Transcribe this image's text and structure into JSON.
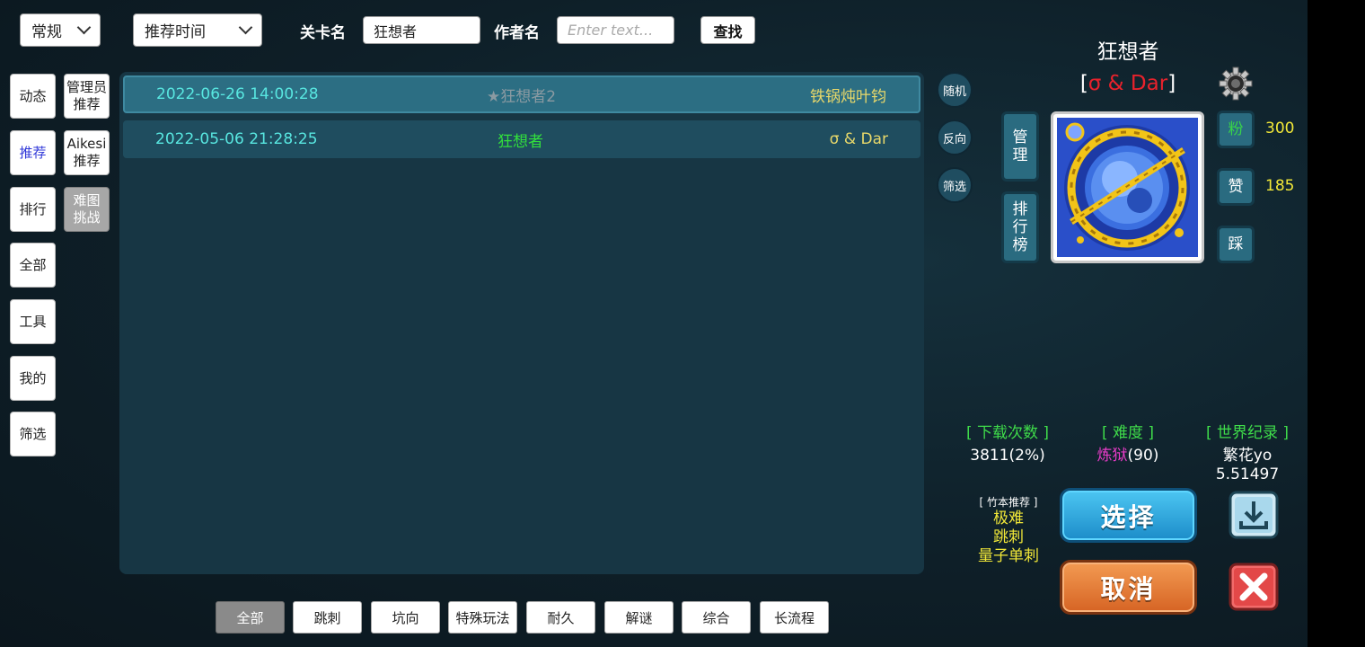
{
  "top": {
    "category_select": "常规",
    "sort_select": "推荐时间",
    "level_label": "关卡名",
    "level_value": "狂想者",
    "author_label": "作者名",
    "author_placeholder": "Enter text...",
    "search_label": "查找"
  },
  "nav": {
    "col1": [
      "动态",
      "推荐",
      "排行",
      "全部",
      "工具",
      "我的",
      "筛选"
    ],
    "active": "推荐",
    "admin_rec": "管理员\n推荐",
    "aikesi_rec": "Aikesi\n推荐",
    "hard_challenge": "难图\n挑战"
  },
  "list": {
    "rows": [
      {
        "date": "2022-06-26 14:00:28",
        "name": "★狂想者2",
        "author": "铁锅炖叶钧"
      },
      {
        "date": "2022-05-06 21:28:25",
        "name": "狂想者",
        "author": "σ & Dar"
      }
    ]
  },
  "side_buttons": {
    "random": "随机",
    "reverse": "反向",
    "filter": "筛选"
  },
  "detail": {
    "title": "狂想者",
    "author_bracket_open": "[",
    "author": "σ & Dar",
    "author_bracket_close": "]",
    "manage": "管\n理",
    "leaderboard": "排\n行\n榜",
    "fans_label": "粉",
    "fans_value": "300",
    "like_label": "赞",
    "like_value": "185",
    "dislike_label": "踩",
    "downloads_head": "[ 下载次数 ]",
    "downloads_value": "3811(2%)",
    "difficulty_head": "[ 难度 ]",
    "difficulty_name": "炼狱",
    "difficulty_num": "(90)",
    "record_head": "[ 世界纪录 ]",
    "record_holder": "繁花yo",
    "record_time": "5.51497",
    "bamboo_head": "[ 竹本推荐 ]",
    "bamboo_tags": [
      "极难",
      "跳刺",
      "量子单刺"
    ],
    "select_btn": "选择",
    "cancel_btn": "取消"
  },
  "tabs": [
    "全部",
    "跳刺",
    "坑向",
    "特殊玩法",
    "耐久",
    "解谜",
    "综合",
    "长流程"
  ],
  "active_tab": "全部",
  "colors": {
    "date": "#58e6e0",
    "name_star": "#8a9aa2",
    "name_green": "#32e03c",
    "author_yellow": "#e8d86a",
    "accent_green": "#3fdc4a",
    "author_red": "#e8222c",
    "yellow": "#f2e838",
    "magenta": "#e83cc8"
  },
  "icons": {
    "gear": "gear-icon",
    "download": "download-icon",
    "close": "close-icon"
  }
}
